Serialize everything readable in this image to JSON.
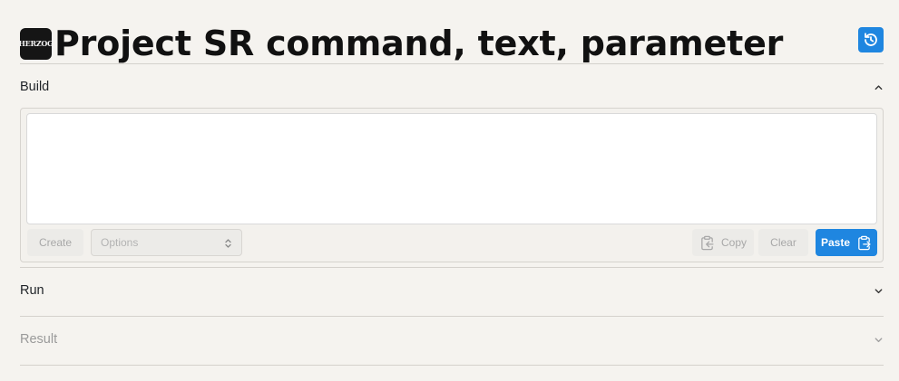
{
  "header": {
    "logo_text": "HERZOG",
    "title": "Project SR command, text, parameter",
    "reset_icon": "history-reset-icon"
  },
  "sections": {
    "build": {
      "label": "Build",
      "expanded": true,
      "icon": "chevron-up-icon"
    },
    "run": {
      "label": "Run",
      "expanded": false,
      "icon": "chevron-down-icon"
    },
    "result": {
      "label": "Result",
      "expanded": false,
      "disabled": true,
      "icon": "chevron-down-icon"
    }
  },
  "build": {
    "textarea_value": "",
    "create_label": "Create",
    "options_placeholder": "Options",
    "copy_label": "Copy",
    "clear_label": "Clear",
    "paste_label": "Paste"
  },
  "colors": {
    "accent": "#1f86e0",
    "background": "#f5f3ef"
  }
}
